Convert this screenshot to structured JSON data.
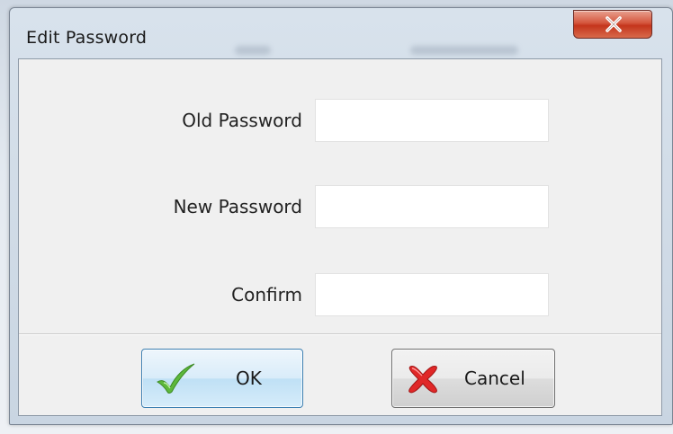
{
  "dialog": {
    "title": "Edit Password",
    "close_symbol": "x"
  },
  "form": {
    "fields": [
      {
        "label": "Old Password",
        "value": ""
      },
      {
        "label": "New Password",
        "value": ""
      },
      {
        "label": "Confirm",
        "value": ""
      }
    ]
  },
  "buttons": {
    "ok_label": "OK",
    "cancel_label": "Cancel"
  },
  "icons": {
    "close": "close-x-icon",
    "ok": "green-checkmark-icon",
    "cancel": "red-x-icon"
  },
  "colors": {
    "close_button": "#d5573e",
    "ok_check": "#5db83b",
    "cancel_x": "#e02828",
    "ok_border": "#3c7fb1"
  }
}
